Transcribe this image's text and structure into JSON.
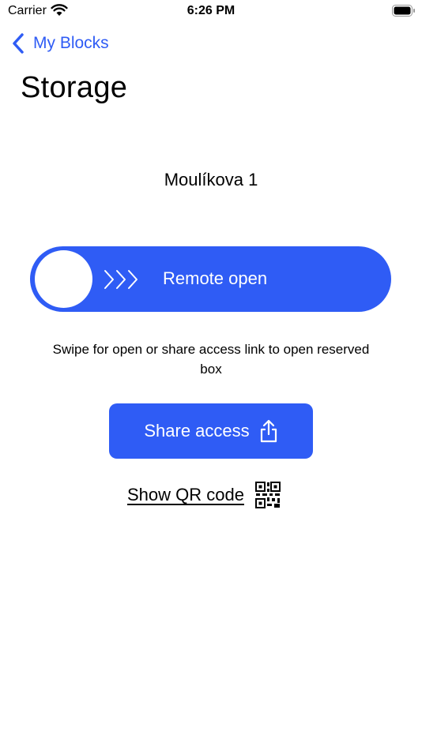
{
  "status_bar": {
    "carrier": "Carrier",
    "time": "6:26 PM"
  },
  "nav": {
    "back_label": "My Blocks"
  },
  "page": {
    "title": "Storage",
    "location": "Moulíkova 1"
  },
  "slider": {
    "label": "Remote open"
  },
  "instruction": "Swipe for open or share access link to open reserved box",
  "share_button": {
    "label": "Share access"
  },
  "qr_link": {
    "label": "Show QR code"
  },
  "colors": {
    "accent": "#2f5cf5",
    "background": "#ffffff",
    "text": "#000000"
  },
  "icons": [
    "wifi-icon",
    "battery-icon",
    "chevron-left-icon",
    "triple-chevron-right-icon",
    "share-upload-icon",
    "qr-code-icon"
  ]
}
